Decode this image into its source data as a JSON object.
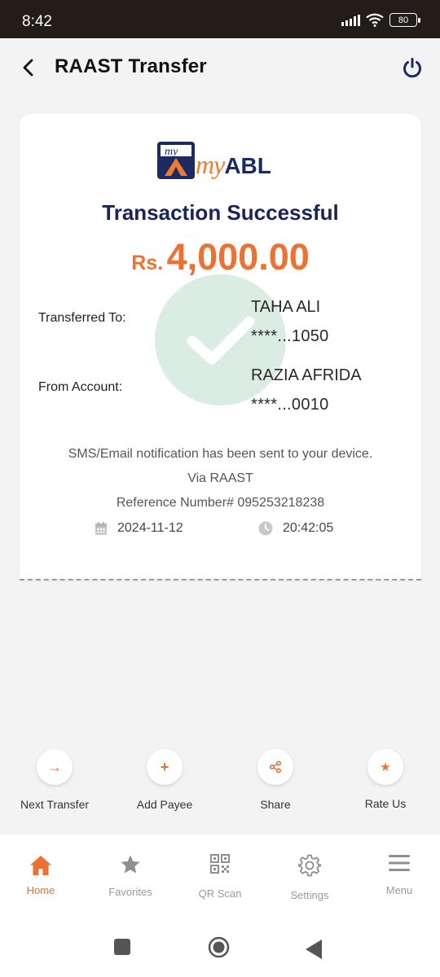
{
  "status": {
    "time": "8:42",
    "battery": "80"
  },
  "header": {
    "title": "RAAST Transfer"
  },
  "logo": {
    "my": "my",
    "abl": "ABL"
  },
  "receipt": {
    "title": "Transaction Successful",
    "currency": "Rs.",
    "amount": "4,000.00",
    "transferred_to_label": "Transferred To:",
    "transferred_to_name": "TAHA ALI",
    "transferred_to_account": "****...1050",
    "from_account_label": "From Account:",
    "from_account_name": "RAZIA AFRIDA",
    "from_account_number": "****...0010",
    "notification": "SMS/Email notification has been sent to your device.",
    "via": "Via RAAST",
    "reference": "Reference Number# 095253218238",
    "date": "2024-11-12",
    "time": "20:42:05"
  },
  "actions": [
    {
      "label": "Next Transfer",
      "icon": "arrow-right-icon",
      "glyph": "→"
    },
    {
      "label": "Add Payee",
      "icon": "plus-icon",
      "glyph": "+"
    },
    {
      "label": "Share",
      "icon": "share-icon",
      "glyph": ""
    },
    {
      "label": "Rate Us",
      "icon": "star-icon",
      "glyph": "★"
    }
  ],
  "nav": [
    {
      "label": "Home",
      "icon": "home-icon",
      "active": true
    },
    {
      "label": "Favorites",
      "icon": "star-icon"
    },
    {
      "label": "QR Scan",
      "icon": "qr-code-icon"
    },
    {
      "label": "Settings",
      "icon": "gear-icon"
    },
    {
      "label": "Menu",
      "icon": "menu-icon"
    }
  ],
  "colors": {
    "accent": "#ea7232",
    "brand_navy": "#1a2458",
    "success_bg": "#d9ebe2"
  }
}
